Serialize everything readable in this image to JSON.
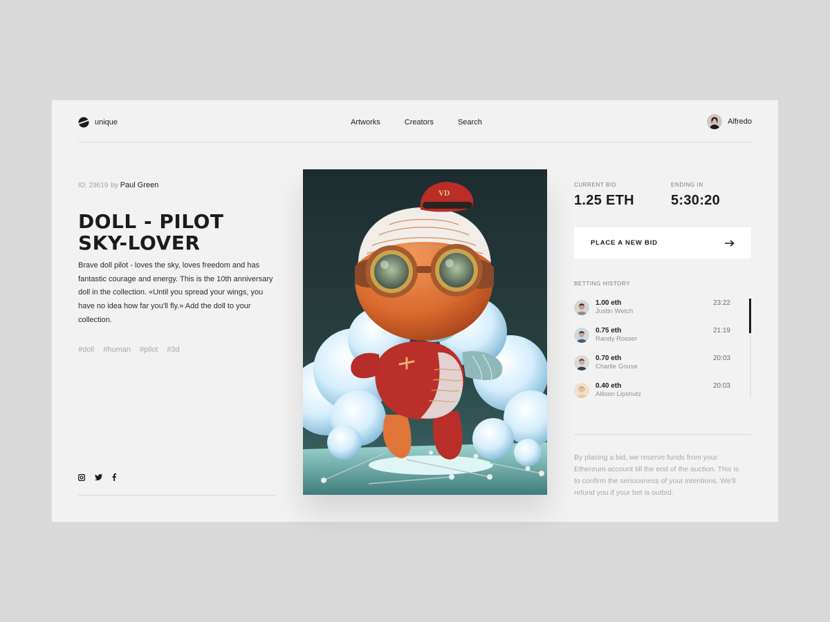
{
  "header": {
    "logo_text": "unique",
    "nav": [
      "Artworks",
      "Creators",
      "Search"
    ],
    "user_name": "Alfredo"
  },
  "artwork": {
    "id_label": "ID: 29619",
    "by_label": "by",
    "author": "Paul Green",
    "title_line1": "DOLL - PILOT",
    "title_line2": "SKY-LOVER",
    "description": "Brave doll pilot - loves the sky, loves freedom and has fantastic courage and energy. This is the 10th anniversary doll in the collection. «Until you spread your wings, you have no idea how far you'll fly.» Add the doll to your collection.",
    "tags": [
      "#doll",
      "#human",
      "#pilot",
      "#3d"
    ],
    "image_name": "doll-pilot-artwork",
    "hat_monogram": "VD"
  },
  "social": [
    "instagram-icon",
    "twitter-icon",
    "facebook-icon"
  ],
  "auction": {
    "current_bid_label": "CURRENT BID",
    "current_bid": "1.25 ETH",
    "ending_label": "ENDING IN",
    "ending_in": "5:30:20",
    "bid_button": "PLACE A NEW BID",
    "history_label": "BETTING HISTORY",
    "history": [
      {
        "amount": "1.00 eth",
        "name": "Justin Wetch",
        "time": "23:22"
      },
      {
        "amount": "0.75 eth",
        "name": "Randy Rosser",
        "time": "21:19"
      },
      {
        "amount": "0.70 eth",
        "name": "Charlie Gouse",
        "time": "20:03"
      },
      {
        "amount": "0.40 eth",
        "name": "Allison Lipshutz",
        "time": "20:03"
      }
    ],
    "note": "By placing a bid, we reserve funds from your Ethereum account till the end of the auction. This is to confirm the seriousness of your intentions. We'll refund you if your bet is outbid."
  },
  "colors": {
    "page_bg": "#dadada",
    "card_bg": "#f2f2f2",
    "text": "#1b1b1b",
    "muted": "#a8a8a8",
    "button_bg": "#ffffff"
  }
}
